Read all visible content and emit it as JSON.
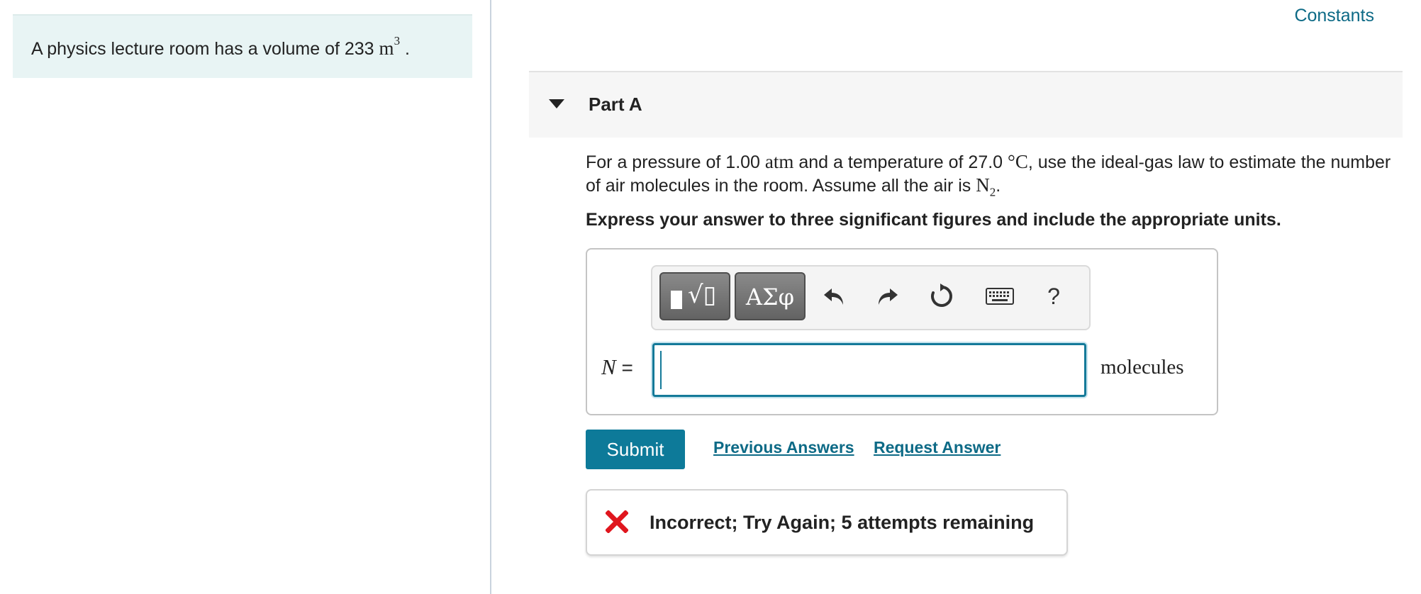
{
  "problem": {
    "text": "A physics lecture room has a volume of 233",
    "unit": "m",
    "unit_exponent": "3",
    "end": "."
  },
  "header": {
    "constants_link": "Constants"
  },
  "part": {
    "title": "Part A",
    "question": {
      "t1": "For a pressure of 1.00",
      "m1": "atm",
      "t2": "and a temperature of 27.0",
      "m2": "°C",
      "t3": ", use the ideal-gas law to estimate the number of air molecules in the room. Assume all the air is",
      "m3": "N",
      "m3_sub": "2",
      "t4": "."
    },
    "instructions": "Express your answer to three significant figures and include the appropriate units."
  },
  "answer": {
    "variable": "N",
    "equals": "=",
    "value": "",
    "unit": "molecules",
    "toolbar": {
      "templates_icon": "templates-icon",
      "greek_label": "ΑΣφ",
      "undo_icon": "undo-icon",
      "redo_icon": "redo-icon",
      "reset_icon": "reset-icon",
      "keyboard_icon": "keyboard-icon",
      "help_label": "?"
    }
  },
  "actions": {
    "submit": "Submit",
    "previous_answers": "Previous Answers",
    "request_answer": "Request Answer"
  },
  "feedback": {
    "status_icon": "incorrect-x-icon",
    "message": "Incorrect; Try Again; 5 attempts remaining",
    "color": "#e0161e"
  },
  "colors": {
    "accent": "#0d7a99",
    "link": "#0d6a86",
    "statement_bg": "#e8f4f4",
    "error": "#e0161e"
  }
}
